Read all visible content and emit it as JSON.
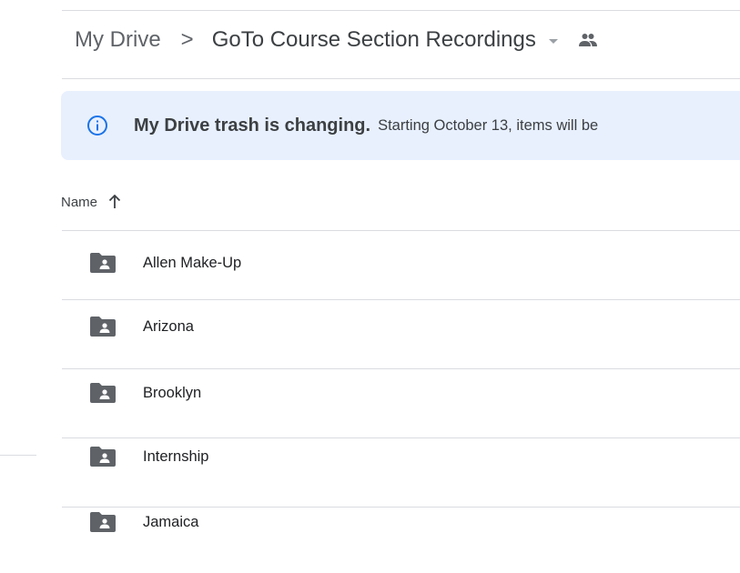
{
  "breadcrumb": {
    "root": "My Drive",
    "separator": ">",
    "current": "GoTo Course Section Recordings"
  },
  "banner": {
    "title": "My Drive trash is changing.",
    "body": "Starting October 13, items will be"
  },
  "list": {
    "column_name": "Name",
    "sort_direction": "ascending",
    "items": [
      {
        "label": "Allen Make-Up",
        "icon": "shared-folder-icon"
      },
      {
        "label": "Arizona",
        "icon": "shared-folder-icon"
      },
      {
        "label": "Brooklyn",
        "icon": "shared-folder-icon"
      },
      {
        "label": "Internship",
        "icon": "shared-folder-icon"
      },
      {
        "label": "Jamaica",
        "icon": "shared-folder-icon"
      }
    ]
  },
  "colors": {
    "banner_bg": "#e8f0fe",
    "info_icon": "#1a73e8",
    "folder_icon": "#5f6368",
    "divider": "#dadce0"
  }
}
